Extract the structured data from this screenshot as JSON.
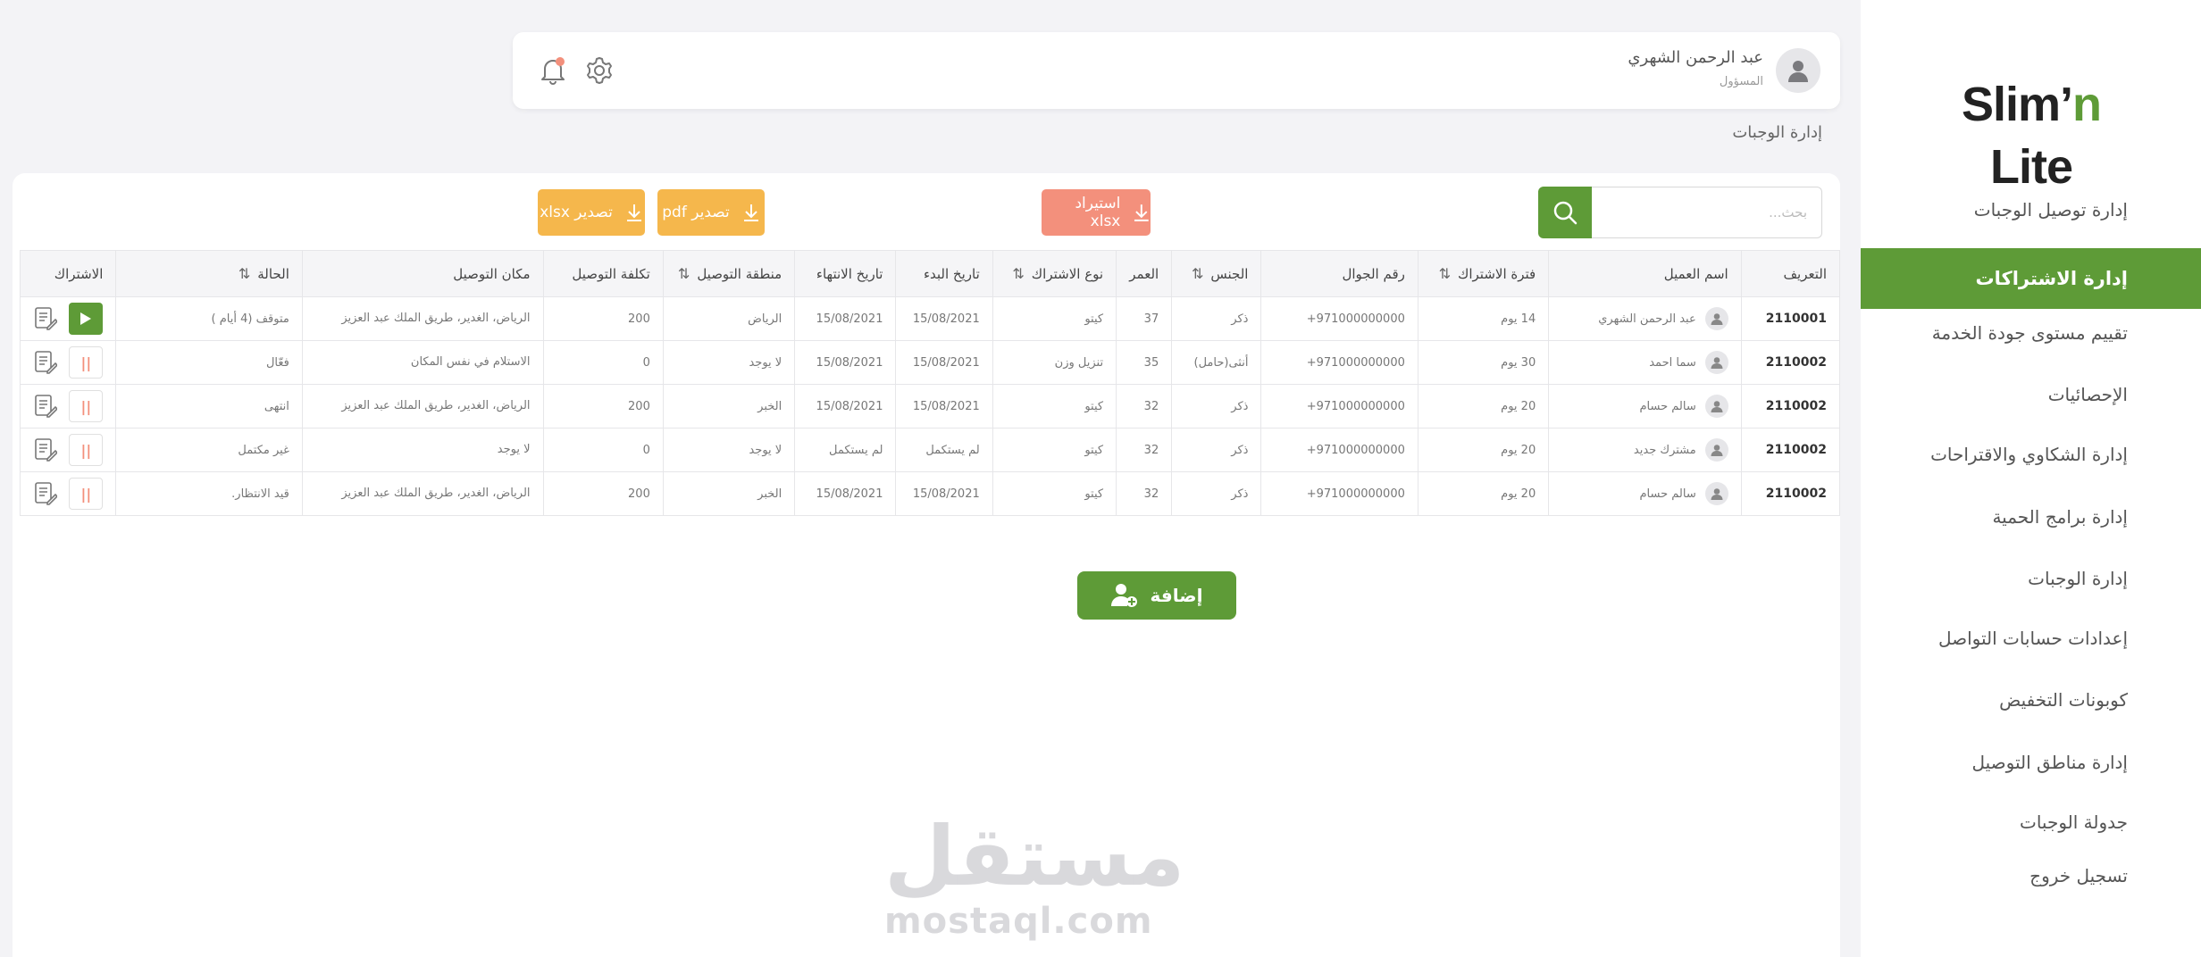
{
  "brand": {
    "logo_part1": "Slim",
    "logo_apos": "’",
    "logo_part2": "n",
    "logo_part3": " Lite",
    "accent": "#5e9b37"
  },
  "sidebar": {
    "items": [
      {
        "label": "إدارة توصيل الوجبات",
        "active": false
      },
      {
        "label": "إدارة الاشتراكات",
        "active": true
      },
      {
        "label": "تقييم مستوى جودة الخدمة",
        "active": false
      },
      {
        "label": "الإحصائيات",
        "active": false
      },
      {
        "label": "إدارة الشكاوي والاقتراحات",
        "active": false
      },
      {
        "label": "إدارة برامج الحمية",
        "active": false
      },
      {
        "label": "إدارة الوجبات",
        "active": false
      },
      {
        "label": "إعدادات حسابات التواصل",
        "active": false
      },
      {
        "label": "كوبونات التخفيض",
        "active": false
      },
      {
        "label": "إدارة مناطق التوصيل",
        "active": false
      },
      {
        "label": "جدولة الوجبات",
        "active": false
      },
      {
        "label": "تسجيل خروج",
        "active": false
      }
    ]
  },
  "header": {
    "user_name": "عبد الرحمن الشهري",
    "user_role": "المسؤول",
    "icons": [
      "user-icon",
      "gear-icon",
      "bell-icon"
    ]
  },
  "breadcrumb": "إدارة الوجبات",
  "toolbar": {
    "search_placeholder": "بحث...",
    "import_label": "استيراد xlsx",
    "export_pdf_label": "تصدير pdf",
    "export_xlsx_label": "تصدير xlsx"
  },
  "table": {
    "headers": [
      "التعريف",
      "اسم العميل",
      "فترة الاشتراك",
      "رقم الجوال",
      "الجنس",
      "العمر",
      "نوع الاشتراك",
      "تاريخ البدء",
      "تاريخ الانتهاء",
      "منطقة التوصيل",
      "تكلفة التوصيل",
      "مكان التوصيل",
      "الحالة",
      "الاشتراك"
    ],
    "rows": [
      {
        "id": "2110001",
        "client": "عبد الرحمن الشهري",
        "period": "14 يوم",
        "phone": "+971000000000",
        "gender": "ذكر",
        "age": "37",
        "type": "كيتو",
        "start": "15/08/2021",
        "end": "15/08/2021",
        "zone": "الرياض",
        "cost": "200",
        "place": "الرياض، الغدير، طريق الملك عبد العزيز",
        "status": "متوقف (4 أيام )"
      },
      {
        "id": "2110002",
        "client": "سما احمد",
        "period": "30 يوم",
        "phone": "+971000000000",
        "gender": "أنثى(حامل)",
        "age": "35",
        "type": "تنزيل وزن",
        "start": "15/08/2021",
        "end": "15/08/2021",
        "zone": "لا يوجد",
        "cost": "0",
        "place": "الاستلام في نفس المكان",
        "status": "فعّال"
      },
      {
        "id": "2110002",
        "client": "سالم حسام",
        "period": "20 يوم",
        "phone": "+971000000000",
        "gender": "ذكر",
        "age": "32",
        "type": "كيتو",
        "start": "15/08/2021",
        "end": "15/08/2021",
        "zone": "الخبر",
        "cost": "200",
        "place": "الرياض، الغدير، طريق الملك عبد العزيز",
        "status": "انتهى"
      },
      {
        "id": "2110002",
        "client": "مشترك جديد",
        "period": "20 يوم",
        "phone": "+971000000000",
        "gender": "ذكر",
        "age": "32",
        "type": "كيتو",
        "start": "لم يستكمل",
        "end": "لم يستكمل",
        "zone": "لا يوجد",
        "cost": "0",
        "place": "لا يوجد",
        "status": "غير مكتمل"
      },
      {
        "id": "2110002",
        "client": "سالم حسام",
        "period": "20 يوم",
        "phone": "+971000000000",
        "gender": "ذكر",
        "age": "32",
        "type": "كيتو",
        "start": "15/08/2021",
        "end": "15/08/2021",
        "zone": "الخبر",
        "cost": "200",
        "place": "الرياض، الغدير، طريق الملك عبد العزيز",
        "status": "قيد الانتظار."
      }
    ]
  },
  "add_button_label": "إضافة",
  "watermark": {
    "arabic": "مستقل",
    "latin": "mostaql.com"
  }
}
